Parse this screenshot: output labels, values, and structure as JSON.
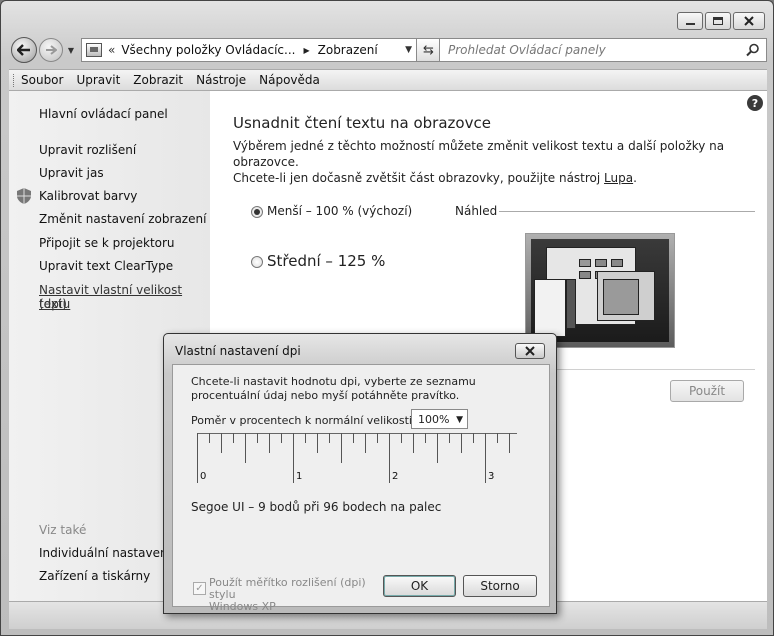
{
  "address": {
    "chevron": "«",
    "segments": [
      "Všechny položky Ovládacíc...",
      "Zobrazení"
    ]
  },
  "search": {
    "placeholder": "Prohledat Ovládací panely"
  },
  "menu": [
    "Soubor",
    "Upravit",
    "Zobrazit",
    "Nástroje",
    "Nápověda"
  ],
  "sidebar": {
    "home": "Hlavní ovládací panel",
    "links": [
      "Upravit rozlišení",
      "Upravit jas",
      "Kalibrovat barvy",
      "Změnit nastavení zobrazení",
      "Připojit se k projektoru",
      "Upravit text ClearType"
    ],
    "current_line1": "Nastavit vlastní velikost textu",
    "current_line2": "(dpi)",
    "see_also": "Viz také",
    "see_also_links": [
      "Individuální nastavení",
      "Zařízení a tiskárny"
    ]
  },
  "main": {
    "title": "Usnadnit čtení textu na obrazovce",
    "desc_line1": "Výběrem jedné z těchto možností můžete změnit velikost textu a další položky na obrazovce.",
    "desc_line2_prefix": "Chcete-li jen dočasně zvětšit část obrazovky, použijte nástroj ",
    "desc_link": "Lupa",
    "desc_suffix": ".",
    "options": [
      {
        "label": "Menší – 100 % (výchozí)",
        "selected": true
      },
      {
        "label": "Střední – 125 %",
        "selected": false
      }
    ],
    "preview_label": "Náhled",
    "apply": "Použít"
  },
  "dialog": {
    "title": "Vlastní nastavení dpi",
    "close": "✕",
    "desc": "Chcete-li nastavit hodnotu dpi, vyberte ze seznamu procentuální údaj nebo myší potáhněte pravítko.",
    "ratio_label": "Poměr v procentech k normální velikosti:",
    "ratio_value": "100%",
    "ruler_labels": [
      "0",
      "1",
      "2",
      "3"
    ],
    "font_info": "Segoe UI – 9 bodů při 96 bodech na palec",
    "xp_line1": "Použít měřítko rozlišení (dpi) stylu",
    "xp_line2": "Windows XP",
    "xp_checked": true,
    "ok": "OK",
    "cancel": "Storno"
  }
}
